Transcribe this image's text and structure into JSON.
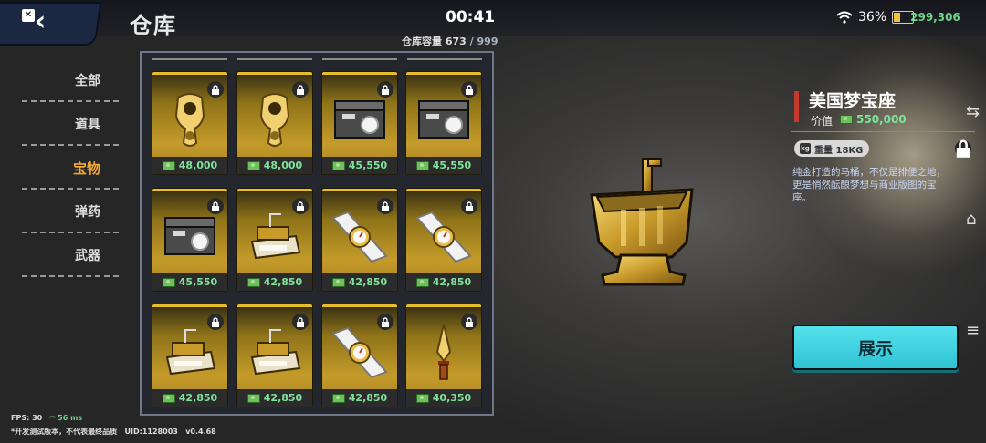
{
  "header": {
    "title": "仓库",
    "clock": "00:41",
    "battery": "36%",
    "top_money": "299,306"
  },
  "capacity": {
    "label": "仓库容量",
    "current": "673",
    "separator": "/",
    "max": "999"
  },
  "sidebar": {
    "items": [
      {
        "label": "全部",
        "active": false
      },
      {
        "label": "道具",
        "active": false
      },
      {
        "label": "宝物",
        "active": true
      },
      {
        "label": "弹药",
        "active": false
      },
      {
        "label": "武器",
        "active": false
      }
    ]
  },
  "items": [
    {
      "icon": "gold-ring-icon",
      "price": "48,000",
      "locked": true
    },
    {
      "icon": "gold-ring-icon",
      "price": "48,000",
      "locked": true
    },
    {
      "icon": "jewelry-box-icon",
      "price": "45,550",
      "locked": true
    },
    {
      "icon": "jewelry-box-icon",
      "price": "45,550",
      "locked": true
    },
    {
      "icon": "jewelry-box-icon",
      "price": "45,550",
      "locked": true
    },
    {
      "icon": "gold-typewriter-icon",
      "price": "42,850",
      "locked": true
    },
    {
      "icon": "diamond-watch-icon",
      "price": "42,850",
      "locked": true
    },
    {
      "icon": "diamond-watch-icon",
      "price": "42,850",
      "locked": true
    },
    {
      "icon": "gold-typewriter-icon",
      "price": "42,850",
      "locked": true
    },
    {
      "icon": "gold-typewriter-icon",
      "price": "42,850",
      "locked": true
    },
    {
      "icon": "diamond-watch-icon",
      "price": "42,850",
      "locked": true
    },
    {
      "icon": "gold-dagger-icon",
      "price": "40,350",
      "locked": true
    }
  ],
  "detail": {
    "name": "美国梦宝座",
    "value_label": "价值",
    "value": "550,000",
    "weight": "重量 18KG",
    "description": "纯金打造的马桶，不仅是排便之地，更是悄然酝酿梦想与商业版图的宝座。",
    "show_button": "展示"
  },
  "footer": {
    "fps": "FPS: 30",
    "ping": "56 ms",
    "note": "*开发测试版本，不代表最终品质",
    "uid": "UID:1128003",
    "version": "v0.4.68"
  },
  "colors": {
    "accent_active": "#f2a72e",
    "money_green": "#7fe39a",
    "show_button": "#3fd2e0",
    "item_gold": "#c49b2a"
  }
}
